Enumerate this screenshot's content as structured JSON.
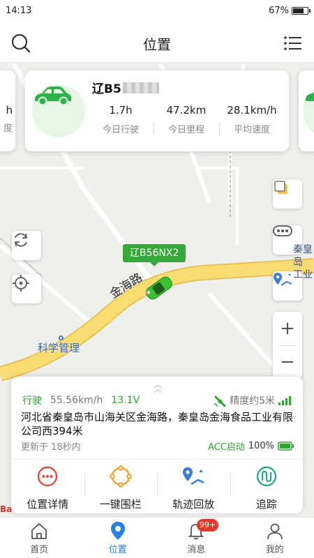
{
  "status_bar": {
    "time": "14:13",
    "battery": "67%",
    "battery_level": 0.67
  },
  "header": {
    "title": "位置",
    "search_icon": "search-icon",
    "menu_icon": "list-menu-icon"
  },
  "vehicle_card": {
    "plate_prefix": "辽B5",
    "stats": [
      {
        "value": "1.7h",
        "label": "今日行驶"
      },
      {
        "value": "47.2km",
        "label": "今日里程"
      },
      {
        "value": "28.1km/h",
        "label": "平均速度"
      }
    ]
  },
  "left_card_partial": {
    "value": "h",
    "label": "度"
  },
  "map": {
    "plate_tag": "辽B56NX2",
    "road_name": "金海路",
    "poi_name": "科学管理",
    "poi_right": "秦皇岛\n工业"
  },
  "map_controls": {
    "layers_icon": "layers-icon",
    "more_icon": "more-dots-icon",
    "route_icon": "route-map-icon",
    "refresh_icon": "refresh-icon",
    "locate_icon": "locate-target-icon",
    "zoom_in": "+",
    "zoom_out": "−"
  },
  "info_panel": {
    "status": "行驶",
    "speed": "55.56km/h",
    "voltage": "13.1V",
    "accuracy": "精度约5米",
    "address": "河北省秦皇岛市山海关区金海路，秦皇岛金海食品工业有限公司西394米",
    "updated": "更新于 18秒内",
    "acc_status": "ACC启动",
    "battery_pct": "100%",
    "colors": {
      "green": "#2aa82a",
      "muted": "#888888"
    }
  },
  "actions": [
    {
      "label": "位置详情",
      "icon": "more-circle-icon",
      "color": "#e54b3c"
    },
    {
      "label": "一键围栏",
      "icon": "fence-circle-icon",
      "color": "#f0a02c"
    },
    {
      "label": "轨迹回放",
      "icon": "track-replay-icon",
      "color": "#3a7bd5"
    },
    {
      "label": "追踪",
      "icon": "tracking-icon",
      "color": "#2aa88a"
    }
  ],
  "map_logo": "Ba",
  "tabbar": {
    "tabs": [
      {
        "label": "首页",
        "icon": "home-icon"
      },
      {
        "label": "位置",
        "icon": "location-pin-icon"
      },
      {
        "label": "消息",
        "icon": "message-bell-icon"
      },
      {
        "label": "我的",
        "icon": "profile-icon"
      }
    ],
    "badge": "99+",
    "active_color": "#2a80e0"
  }
}
